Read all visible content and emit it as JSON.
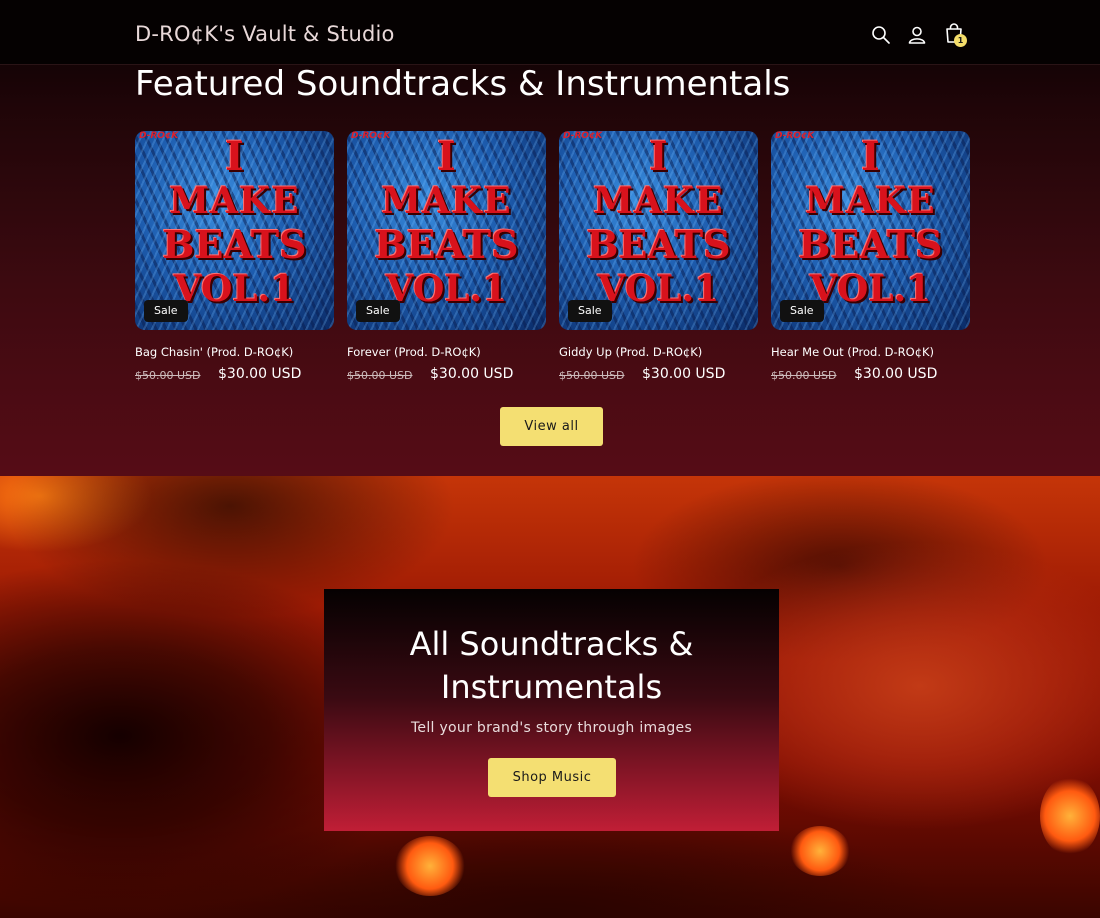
{
  "header": {
    "brand": "D-RO¢K's Vault & Studio",
    "icons": [
      "search-icon",
      "account-icon",
      "cart-icon"
    ],
    "cart_count": "1"
  },
  "featured": {
    "title": "Featured Soundtracks & Instrumentals",
    "products": [
      {
        "title": "Bag Chasin' (Prod. D-RO¢K)",
        "old_price": "$50.00 USD",
        "new_price": "$30.00 USD",
        "badge": "Sale",
        "art": {
          "logo": "D-RO¢K",
          "line1": "I",
          "line2": "MAKE",
          "line3": "BEATS",
          "line4": "VOL.1"
        }
      },
      {
        "title": "Forever (Prod. D-RO¢K)",
        "old_price": "$50.00 USD",
        "new_price": "$30.00 USD",
        "badge": "Sale",
        "art": {
          "logo": "D-RO¢K",
          "line1": "I",
          "line2": "MAKE",
          "line3": "BEATS",
          "line4": "VOL.1"
        }
      },
      {
        "title": "Giddy Up (Prod. D-RO¢K)",
        "old_price": "$50.00 USD",
        "new_price": "$30.00 USD",
        "badge": "Sale",
        "art": {
          "logo": "D-RO¢K",
          "line1": "I",
          "line2": "MAKE",
          "line3": "BEATS",
          "line4": "VOL.1"
        }
      },
      {
        "title": "Hear Me Out (Prod. D-RO¢K)",
        "old_price": "$50.00 USD",
        "new_price": "$30.00 USD",
        "badge": "Sale",
        "art": {
          "logo": "D-RO¢K",
          "line1": "I",
          "line2": "MAKE",
          "line3": "BEATS",
          "line4": "VOL.1"
        }
      }
    ],
    "view_all_label": "View all"
  },
  "promo": {
    "title_line1": "All Soundtracks &",
    "title_line2": "Instrumentals",
    "subtitle": "Tell your brand's story through images",
    "button_label": "Shop Music"
  },
  "colors": {
    "accent_button": "#f4df72",
    "header_bg": "#050101",
    "sale_badge": "#111111"
  }
}
